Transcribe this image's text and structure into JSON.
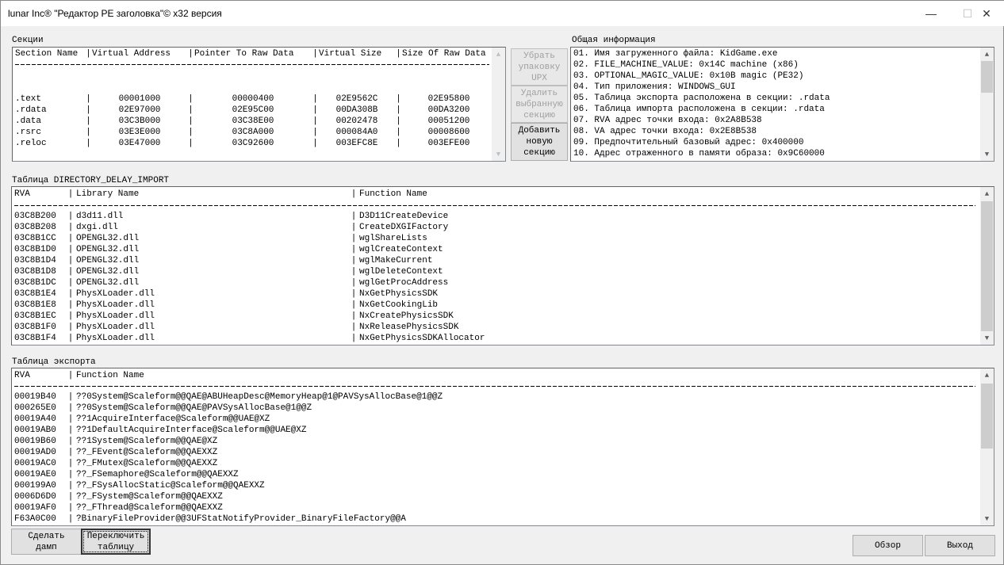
{
  "window": {
    "title": "lunar Inc® \"Редактор PE заголовка\"© x32 версия",
    "minimize": "—",
    "maximize": "☐",
    "close": "✕"
  },
  "sections": {
    "label": "Секции",
    "headers": [
      "Section Name",
      "Virtual Address",
      "Pointer To Raw Data",
      "Virtual Size",
      "Size Of Raw Data"
    ],
    "rows": [
      [
        ".text",
        "00001000",
        "00000400",
        "02E9562C",
        "02E95800"
      ],
      [
        ".rdata",
        "02E97000",
        "02E95C00",
        "00DA308B",
        "00DA3200"
      ],
      [
        ".data",
        "03C3B000",
        "03C38E00",
        "00202478",
        "00051200"
      ],
      [
        ".rsrc",
        "03E3E000",
        "03C8A000",
        "000084A0",
        "00008600"
      ],
      [
        ".reloc",
        "03E47000",
        "03C92600",
        "003EFC8E",
        "003EFE00"
      ]
    ]
  },
  "side_buttons": {
    "remove_upx": "Убрать\nупаковку\nUPX",
    "delete_section": "Удалить\nвыбранную\nсекцию",
    "add_section": "Добавить\nновую\nсекцию"
  },
  "info": {
    "label": "Общая информация",
    "lines": [
      "01. Имя загруженного файла: KidGame.exe",
      "02. FILE_MACHINE_VALUE: 0x14C machine (x86)",
      "03. OPTIONAL_MAGIC_VALUE: 0x10B magic (PE32)",
      "04. Тип приложения: WINDOWS_GUI",
      "05. Таблица экспорта расположена в секции: .rdata",
      "06. Таблица импорта расположена в секции: .rdata",
      "07. RVA адрес точки входа: 0x2A8B538",
      "08. VA адрес точки входа: 0x2E8B538",
      "09. Предпочтительный базовый адрес: 0x400000",
      "10. Адрес отраженного в памяти образа: 0x9C60000"
    ]
  },
  "delay": {
    "label": "Таблица DIRECTORY_DELAY_IMPORT",
    "headers": [
      "RVA",
      "Library Name",
      "Function Name"
    ],
    "rows": [
      [
        "03C8B200",
        "d3d11.dll",
        "D3D11CreateDevice"
      ],
      [
        "03C8B208",
        "dxgi.dll",
        "CreateDXGIFactory"
      ],
      [
        "03C8B1CC",
        "OPENGL32.dll",
        "wglShareLists"
      ],
      [
        "03C8B1D0",
        "OPENGL32.dll",
        "wglCreateContext"
      ],
      [
        "03C8B1D4",
        "OPENGL32.dll",
        "wglMakeCurrent"
      ],
      [
        "03C8B1D8",
        "OPENGL32.dll",
        "wglDeleteContext"
      ],
      [
        "03C8B1DC",
        "OPENGL32.dll",
        "wglGetProcAddress"
      ],
      [
        "03C8B1E4",
        "PhysXLoader.dll",
        "NxGetPhysicsSDK"
      ],
      [
        "03C8B1E8",
        "PhysXLoader.dll",
        "NxGetCookingLib"
      ],
      [
        "03C8B1EC",
        "PhysXLoader.dll",
        "NxCreatePhysicsSDK"
      ],
      [
        "03C8B1F0",
        "PhysXLoader.dll",
        "NxReleasePhysicsSDK"
      ],
      [
        "03C8B1F4",
        "PhysXLoader.dll",
        "NxGetPhysicsSDKAllocator"
      ]
    ]
  },
  "export": {
    "label": "Таблица экспорта",
    "headers": [
      "RVA",
      "Function Name"
    ],
    "rows": [
      [
        "00019B40",
        "??0System@Scaleform@@QAE@ABUHeapDesc@MemoryHeap@1@PAVSysAllocBase@1@@Z"
      ],
      [
        "000265E0",
        "??0System@Scaleform@@QAE@PAVSysAllocBase@1@@Z"
      ],
      [
        "00019A40",
        "??1AcquireInterface@Scaleform@@UAE@XZ"
      ],
      [
        "00019AB0",
        "??1DefaultAcquireInterface@Scaleform@@UAE@XZ"
      ],
      [
        "00019B60",
        "??1System@Scaleform@@QAE@XZ"
      ],
      [
        "00019AD0",
        "??_FEvent@Scaleform@@QAEXXZ"
      ],
      [
        "00019AC0",
        "??_FMutex@Scaleform@@QAEXXZ"
      ],
      [
        "00019AE0",
        "??_FSemaphore@Scaleform@@QAEXXZ"
      ],
      [
        "000199A0",
        "??_FSysAllocStatic@Scaleform@@QAEXXZ"
      ],
      [
        "0006D6D0",
        "??_FSystem@Scaleform@@QAEXXZ"
      ],
      [
        "00019AF0",
        "??_FThread@Scaleform@@QAEXXZ"
      ],
      [
        "F63A0C00",
        "?BinaryFileProvider@@3UFStatNotifyProvider_BinaryFileFactory@@A"
      ]
    ]
  },
  "bottom": {
    "dump": "Сделать\nдамп",
    "switch_table": "Переключить\nтаблицу",
    "browse": "Обзор",
    "exit": "Выход"
  }
}
